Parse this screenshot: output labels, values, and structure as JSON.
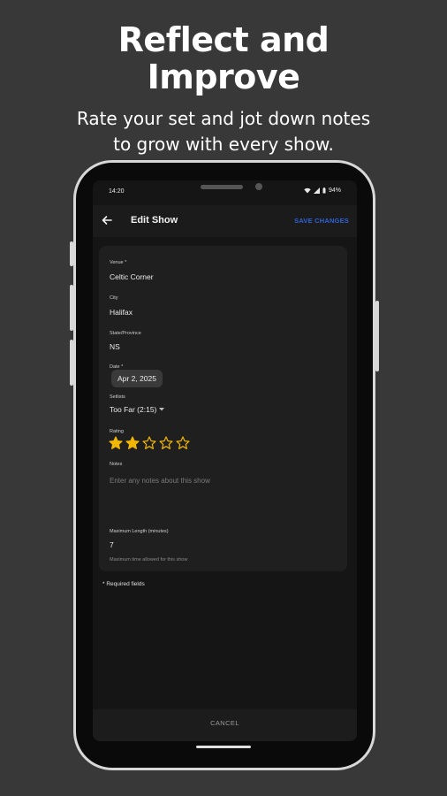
{
  "promo": {
    "headline_line1": "Reflect and",
    "headline_line2": "Improve",
    "subhead_line1": "Rate your set and jot down notes",
    "subhead_line2": "to grow with every show."
  },
  "status_bar": {
    "time": "14:20",
    "indicators": "M 3A",
    "battery": "94%"
  },
  "app_bar": {
    "title": "Edit Show",
    "save_label": "SAVE CHANGES"
  },
  "form": {
    "venue": {
      "label": "Venue *",
      "value": "Celtic Corner"
    },
    "city": {
      "label": "City",
      "value": "Halifax"
    },
    "state": {
      "label": "State/Province",
      "value": "NS"
    },
    "date": {
      "label": "Date *",
      "value": "Apr 2, 2025"
    },
    "setlist": {
      "label": "Setlists",
      "value": "Too Far (2:15)"
    },
    "rating": {
      "label": "Rating",
      "value": 2,
      "max": 5
    },
    "notes": {
      "label": "Notes",
      "placeholder": "Enter any notes about this show"
    },
    "max_length": {
      "label": "Maximum Length (minutes)",
      "value": "7",
      "helper": "Maximum time allowed for this show"
    },
    "required_note": "* Required fields"
  },
  "cancel_label": "CANCEL",
  "colors": {
    "background": "#383838",
    "screen": "#151515",
    "card": "#1f1f1f",
    "accent": "#2f62d9",
    "star": "#f2b705"
  },
  "icons": {
    "back": "arrow-left-icon",
    "dropdown": "caret-down-icon",
    "star_filled": "star-filled-icon",
    "star_empty": "star-outline-icon",
    "wifi": "wifi-icon",
    "signal": "signal-icon",
    "battery": "battery-icon"
  }
}
